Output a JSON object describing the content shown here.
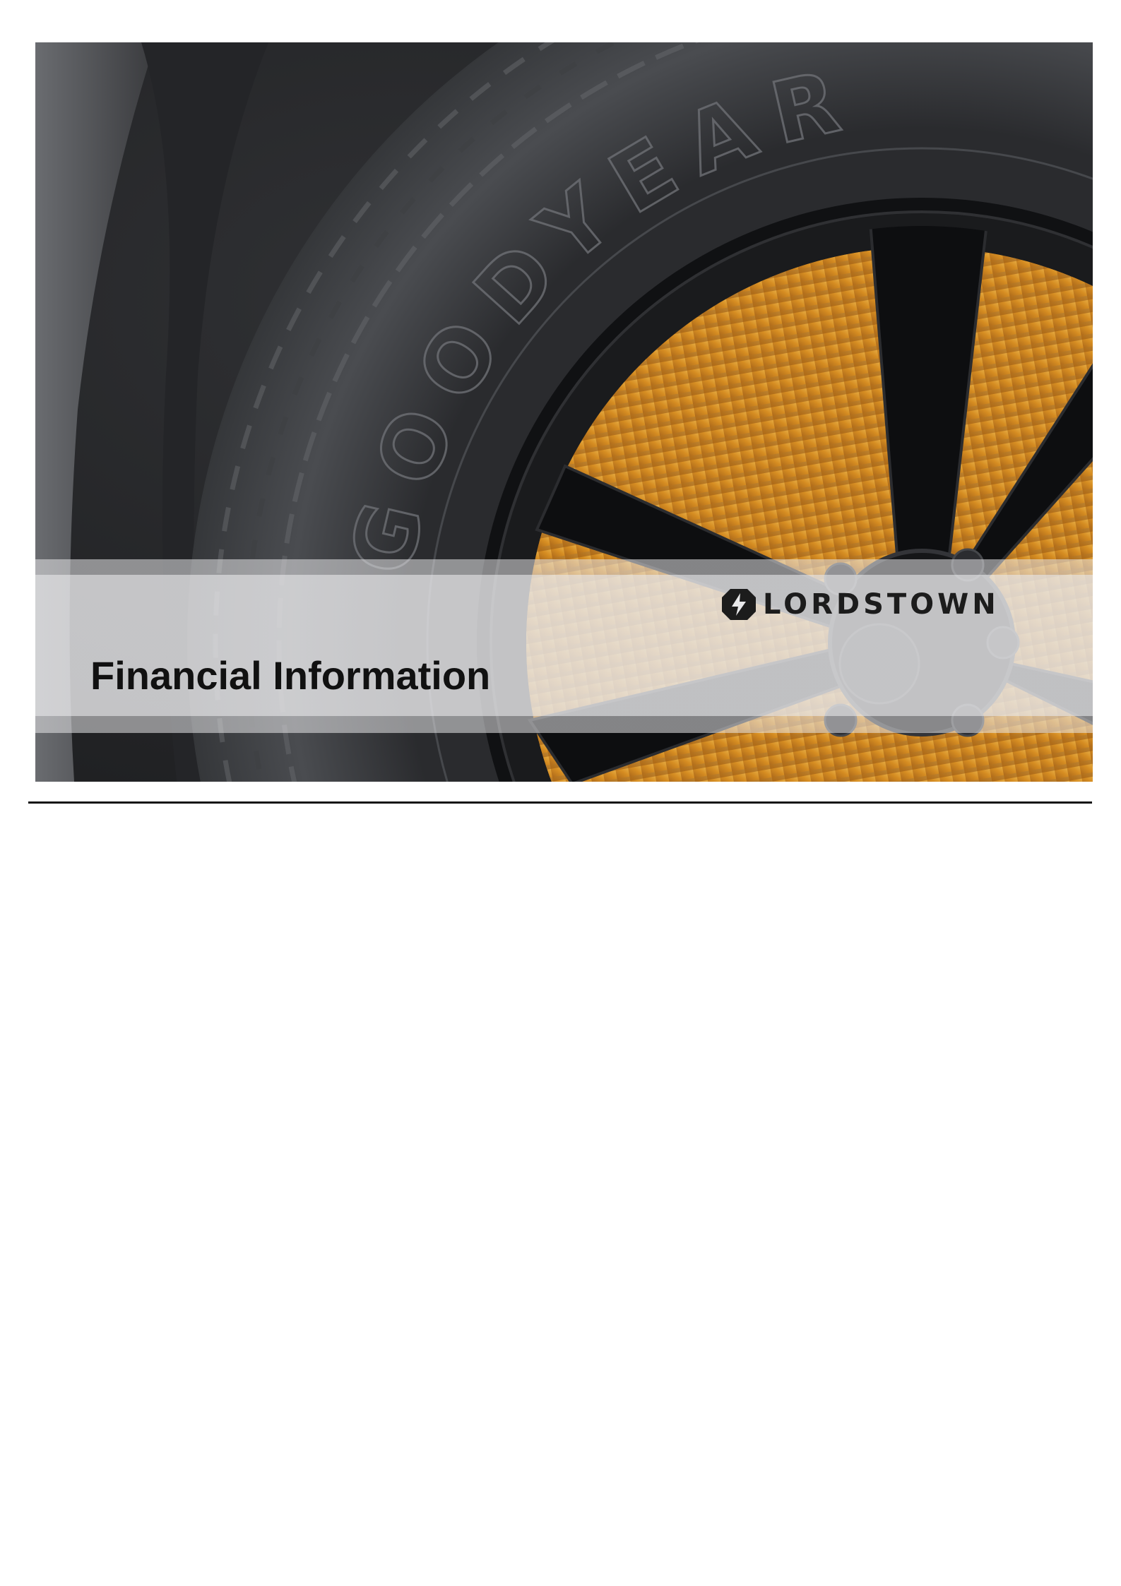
{
  "page": {
    "title": "Financial Information"
  },
  "brand": {
    "name": "LORDSTOWN",
    "logo_icon": "lordstown-lightning-icon",
    "color": "#1c1c1c"
  },
  "photo": {
    "icon": "tire-wheel-photo",
    "accent_color": "#e6a534",
    "tire_text": "GOODYEAR"
  }
}
